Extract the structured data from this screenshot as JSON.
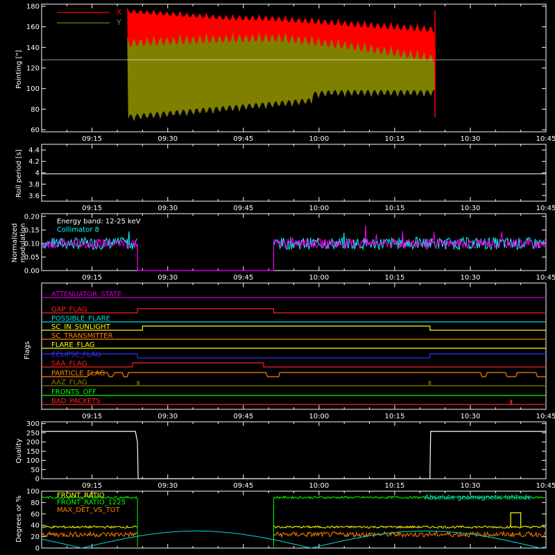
{
  "colors": {
    "background": "#000000",
    "axis": "#ffffff",
    "x_series": "#ff0000",
    "y_series": "#808000",
    "magenta": "#ff00ff",
    "cyan": "#00ffff",
    "green": "#00ff00",
    "yellow": "#ffff00",
    "orange": "#ff8000"
  },
  "chart_data": [
    {
      "id": "pointing",
      "type": "line",
      "ylabel": "Pointing [\"]",
      "ylim": [
        58,
        182
      ],
      "yticks": [
        60,
        80,
        100,
        120,
        140,
        160,
        180
      ],
      "xticks": [
        "09:15",
        "09:30",
        "09:45",
        "10:00",
        "10:15",
        "10:30",
        "10:45"
      ],
      "legend": "top-left",
      "series": [
        {
          "name": "X",
          "color": "#ff0000",
          "x_start": "09:22",
          "x_end": "10:23",
          "upper": 175,
          "lower": 78
        },
        {
          "name": "Y",
          "color": "#808000",
          "x_start": "09:22",
          "x_end": "10:23",
          "upper": 150,
          "lower": 85
        }
      ],
      "reference_line": 128
    },
    {
      "id": "roll",
      "type": "line",
      "ylabel": "Roll period [s]",
      "ylim": [
        3.5,
        4.5
      ],
      "yticks": [
        3.6,
        3.8,
        4.0,
        4.2,
        4.4
      ],
      "xticks": [
        "09:15",
        "09:30",
        "09:45",
        "10:00",
        "10:15",
        "10:30",
        "10:45"
      ],
      "value": 3.98
    },
    {
      "id": "modulation",
      "type": "line",
      "ylabel": "Normalized modulation",
      "ylim": [
        0,
        0.21
      ],
      "yticks": [
        "0.00",
        "0.05",
        "0.10",
        "0.15",
        "0.20"
      ],
      "xticks": [
        "09:15",
        "09:30",
        "09:45",
        "10:00",
        "10:15",
        "10:30",
        "10:45"
      ],
      "annotation": "Energy band: 12-25 keV",
      "series": [
        {
          "name": "Collimator 8",
          "color": "#00ffff"
        }
      ],
      "gap": [
        "09:24",
        "09:51"
      ],
      "level": 0.1
    },
    {
      "id": "flags",
      "type": "line",
      "ylabel": "Flags",
      "xticks": [
        "09:15",
        "09:30",
        "09:45",
        "10:00",
        "10:15",
        "10:30",
        "10:45"
      ],
      "flags": [
        {
          "label": "ATTENUATOR_STATE",
          "color": "#cc00cc"
        },
        {
          "label": "GAP_FLAG",
          "color": "#ff2020"
        },
        {
          "label": "POSSIBLE_FLARE",
          "color": "#00dddd"
        },
        {
          "label": "SC_IN_SUNLIGHT",
          "color": "#ffff00"
        },
        {
          "label": "SC_TRANSMITTER",
          "color": "#ff8000"
        },
        {
          "label": "FLARE_FLAG",
          "color": "#ffff00"
        },
        {
          "label": "ECLIPSE_FLAG",
          "color": "#3030ff"
        },
        {
          "label": "SAA_FLAG",
          "color": "#ff2020"
        },
        {
          "label": "PARTICLE_FLAG",
          "color": "#ff8000"
        },
        {
          "label": "AAZ_FLAG",
          "color": "#808000"
        },
        {
          "label": "FRONTS_OFF",
          "color": "#00ff00"
        },
        {
          "label": "BAD_PACKETS",
          "color": "#ff2020"
        }
      ]
    },
    {
      "id": "quality",
      "type": "line",
      "ylabel": "Quality",
      "ylim": [
        0,
        310
      ],
      "yticks": [
        0,
        50,
        100,
        150,
        200,
        250,
        300
      ],
      "xticks": [
        "09:15",
        "09:30",
        "09:45",
        "10:00",
        "10:15",
        "10:30",
        "10:45"
      ],
      "high": 258,
      "low_start": "09:24",
      "low_end": "10:22"
    },
    {
      "id": "degrees",
      "type": "line",
      "ylabel": "Degrees or %",
      "ylim": [
        0,
        100
      ],
      "yticks": [
        0,
        20,
        40,
        60,
        80,
        100
      ],
      "legend": "top-left",
      "series": [
        {
          "name": "FRONT_RATIO",
          "color": "#ffff00"
        },
        {
          "name": "FRONT_RATIO_1225",
          "color": "#00ff00"
        },
        {
          "name": "MAX_DET_VS_TOT",
          "color": "#ff8000"
        },
        {
          "name": "Absolute geomagnetic latitude",
          "color": "#00dddd"
        }
      ]
    }
  ]
}
